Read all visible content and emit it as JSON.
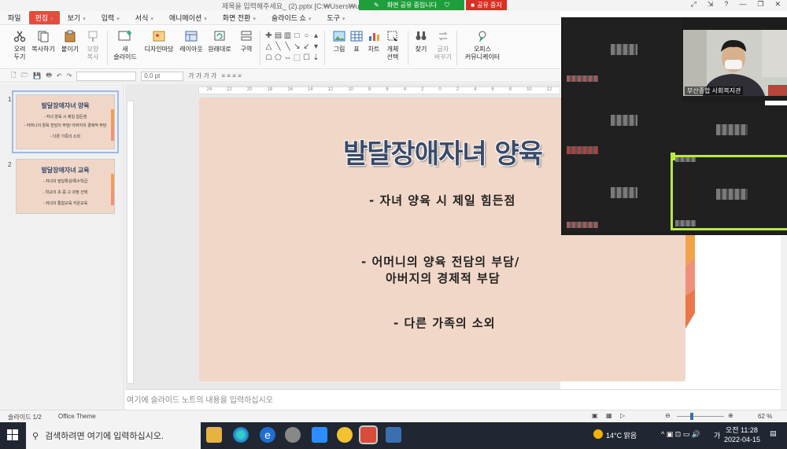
{
  "window": {
    "title": "제목을 입력해주세요_ (2).pptx [C:₩Users₩u",
    "controls": [
      "⤢",
      "⇲",
      "?",
      "—",
      "❐",
      "✕"
    ]
  },
  "share": {
    "banner": "화면 공유 중입니다",
    "stop": "공유 중지"
  },
  "menu": {
    "items": [
      "파일",
      "편집",
      "보기",
      "입력",
      "서식",
      "애니메이션",
      "화면 전환",
      "슬라이드 쇼",
      "도구"
    ],
    "active": "편집"
  },
  "ribbon": {
    "cut": "오려\n두기",
    "copy": "복사하기",
    "paste": "붙이기",
    "format_copy": "모양\n복사",
    "new_slide": "새\n슬라이드",
    "design": "디자인마당",
    "layout": "레이아웃",
    "reset": "원래대로",
    "section": "구역",
    "picture": "그림",
    "table": "표",
    "chart": "차트",
    "select_object": "개체\n선택",
    "find": "찾기",
    "replace": "글자\n바꾸기",
    "office_comm": "오피스\n커뮤니케이터"
  },
  "toolbar2": {
    "size": "0.0",
    "unit": "pt"
  },
  "thumbnails": [
    {
      "num": "1",
      "title": "발달장애자녀 양육",
      "lines": [
        "- 자녀 양육 시 제일 힘든점",
        "- 어머니의 양육 전담의 부담/ 아버지의 경제적 부담",
        "- 다른 가족의 소외"
      ]
    },
    {
      "num": "2",
      "title": "발달장애자녀 교육",
      "lines": [
        "- 자녀의 발달특성/특수학급",
        "- 학교의 초·중·고 과정 선택",
        "- 자녀의 통합교육 지원교육"
      ]
    }
  ],
  "ruler_ticks": [
    "24",
    "22",
    "20",
    "18",
    "16",
    "14",
    "12",
    "10",
    "8",
    "6",
    "4",
    "2",
    "0",
    "2",
    "4",
    "6",
    "8",
    "10",
    "12"
  ],
  "slide": {
    "title": "발달장애자녀 양육",
    "bullets": [
      "- 자녀 양육 시 제일 힘든점",
      "- 어머니의 양육 전담의 부담/",
      "아버지의 경제적 부담",
      "- 다른 가족의 소외"
    ]
  },
  "notes_placeholder": "여기에 슬라이드 노트의 내용을 입력하십시오",
  "status": {
    "slide": "슬라이드 1/2",
    "theme": "Office Theme",
    "zoom": "62 %"
  },
  "taskbar": {
    "search": "검색하려면 여기에 입력하십시오.",
    "weather": "14°C 맑음",
    "ime": "가",
    "time": "오전 11:28",
    "date": "2022-04-15"
  },
  "video": {
    "cam_name": "부산종합 사회복지관"
  },
  "colors": {
    "accent": "#e84b3c",
    "share_green": "#1f9f3c",
    "stop_red": "#d93025",
    "slide_bg": "#f1d7c7",
    "title_color": "#3b4a68"
  }
}
